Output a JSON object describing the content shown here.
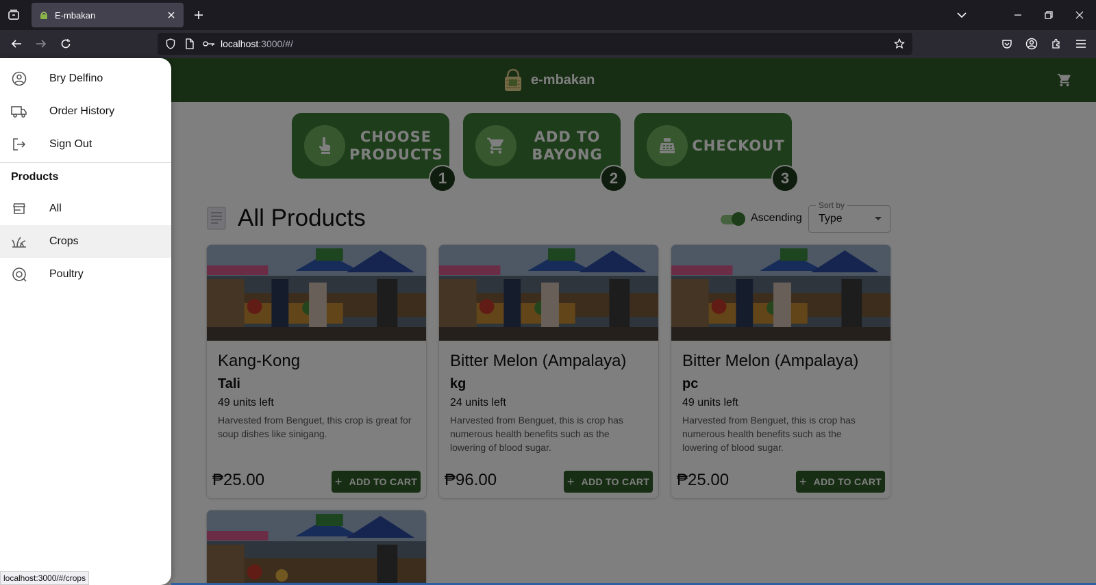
{
  "browser": {
    "tab_title": "E-mbakan",
    "url_host": "localhost",
    "url_path": ":3000/#/",
    "status_url": "localhost:3000/#/crops"
  },
  "app": {
    "brand": "e-mbakan",
    "steps": [
      {
        "label": "CHOOSE PRODUCTS",
        "number": "1",
        "icon": "hand-pointer-icon"
      },
      {
        "label": "ADD TO BAYONG",
        "number": "2",
        "icon": "cart-icon"
      },
      {
        "label": "CHECKOUT",
        "number": "3",
        "icon": "cash-register-icon"
      }
    ],
    "section_title": "All Products",
    "sort": {
      "toggle_label": "Ascending",
      "ascending": true,
      "select_label": "Sort by",
      "select_value": "Type"
    },
    "products": [
      {
        "name": "Kang-Kong",
        "unit": "Tali",
        "stock": "49 units left",
        "description": "Harvested from Benguet, this crop is great for soup dishes like sinigang.",
        "price": "₱25.00",
        "button": "ADD TO CART"
      },
      {
        "name": "Bitter Melon (Ampalaya)",
        "unit": "kg",
        "stock": "24 units left",
        "description": "Harvested from Benguet, this is crop has numerous health benefits such as the lowering of blood sugar.",
        "price": "₱96.00",
        "button": "ADD TO CART"
      },
      {
        "name": "Bitter Melon (Ampalaya)",
        "unit": "pc",
        "stock": "49 units left",
        "description": "Harvested from Benguet, this is crop has numerous health benefits such as the lowering of blood sugar.",
        "price": "₱25.00",
        "button": "ADD TO CART"
      }
    ]
  },
  "drawer": {
    "account": [
      {
        "label": "Bry Delfino",
        "icon": "account-circle-icon"
      },
      {
        "label": "Order History",
        "icon": "truck-icon"
      },
      {
        "label": "Sign Out",
        "icon": "logout-icon"
      }
    ],
    "products_heading": "Products",
    "categories": [
      {
        "label": "All",
        "icon": "store-icon"
      },
      {
        "label": "Crops",
        "icon": "grass-icon",
        "active": true
      },
      {
        "label": "Poultry",
        "icon": "egg-icon"
      }
    ]
  },
  "colors": {
    "brand_green": "#2e5d28",
    "step_green": "#3c7a34",
    "browser_dark": "#1c1b22"
  }
}
